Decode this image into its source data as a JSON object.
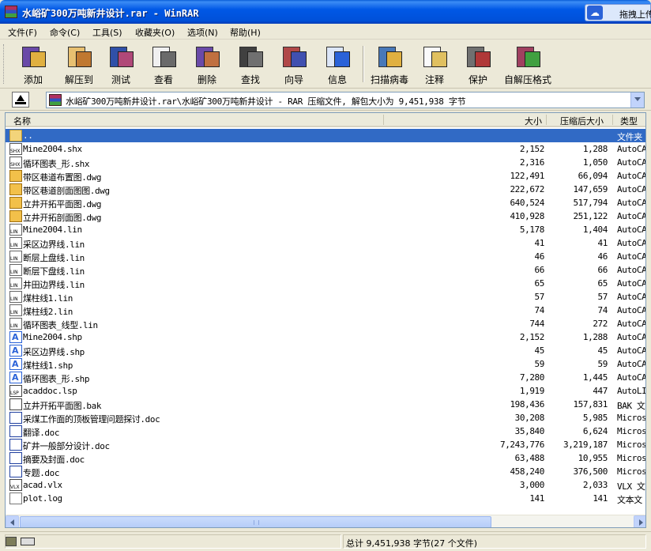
{
  "window": {
    "title": "水峪矿300万吨新井设计.rar - WinRAR",
    "extension_button_label": "拖拽上传"
  },
  "menu": [
    {
      "label": "文件(F)"
    },
    {
      "label": "命令(C)"
    },
    {
      "label": "工具(S)"
    },
    {
      "label": "收藏夹(O)"
    },
    {
      "label": "选项(N)"
    },
    {
      "label": "帮助(H)"
    }
  ],
  "toolbar": [
    {
      "label": "添加",
      "icon": "add-archive-icon",
      "color": "#6a4aa8"
    },
    {
      "label": "解压到",
      "icon": "extract-to-icon",
      "color": "#d8a040"
    },
    {
      "label": "测试",
      "icon": "test-icon",
      "color": "#3050a8"
    },
    {
      "label": "查看",
      "icon": "view-icon",
      "color": "#6a6a6a"
    },
    {
      "label": "删除",
      "icon": "delete-icon",
      "color": "#c07040"
    },
    {
      "label": "查找",
      "icon": "find-icon",
      "color": "#404040"
    },
    {
      "label": "向导",
      "icon": "wizard-icon",
      "color": "#b04848"
    },
    {
      "label": "信息",
      "icon": "info-icon",
      "color": "#2a62d8"
    },
    {
      "label": "扫描病毒",
      "icon": "virus-scan-icon",
      "color": "#4878b8"
    },
    {
      "label": "注释",
      "icon": "comment-icon",
      "color": "#e0c060"
    },
    {
      "label": "保护",
      "icon": "protect-icon",
      "color": "#707070"
    },
    {
      "label": "自解压格式",
      "icon": "sfx-icon",
      "color": "#a04060"
    }
  ],
  "address": {
    "text": "水峪矿300万吨新井设计.rar\\水峪矿300万吨新井设计 - RAR 压缩文件, 解包大小为 9,451,938 字节"
  },
  "columns": {
    "name": "名称",
    "size": "大小",
    "packed": "压缩后大小",
    "type": "类型"
  },
  "files": [
    {
      "name": "..",
      "size": "",
      "packed": "",
      "type": "文件夹",
      "icon": "folder-up-icon",
      "kind": "folder",
      "tag": ""
    },
    {
      "name": "Mine2004.shx",
      "size": "2,152",
      "packed": "1,288",
      "type": "AutoCA",
      "icon": "shx-file-icon",
      "kind": "shx",
      "tag": "SHX"
    },
    {
      "name": "循环图表_形.shx",
      "size": "2,316",
      "packed": "1,050",
      "type": "AutoCA",
      "icon": "shx-file-icon",
      "kind": "shx",
      "tag": "SHX"
    },
    {
      "name": "带区巷道布置图.dwg",
      "size": "122,491",
      "packed": "66,094",
      "type": "AutoCA",
      "icon": "dwg-file-icon",
      "kind": "dwg",
      "tag": ""
    },
    {
      "name": "带区巷道剖面图图.dwg",
      "size": "222,672",
      "packed": "147,659",
      "type": "AutoCA",
      "icon": "dwg-file-icon",
      "kind": "dwg",
      "tag": ""
    },
    {
      "name": "立井开拓平面图.dwg",
      "size": "640,524",
      "packed": "517,794",
      "type": "AutoCA",
      "icon": "dwg-file-icon",
      "kind": "dwg",
      "tag": ""
    },
    {
      "name": "立井开拓剖面图.dwg",
      "size": "410,928",
      "packed": "251,122",
      "type": "AutoCA",
      "icon": "dwg-file-icon",
      "kind": "dwg",
      "tag": ""
    },
    {
      "name": "Mine2004.lin",
      "size": "5,178",
      "packed": "1,404",
      "type": "AutoCA",
      "icon": "lin-file-icon",
      "kind": "lin",
      "tag": "LIN"
    },
    {
      "name": "采区边界线.lin",
      "size": "41",
      "packed": "41",
      "type": "AutoCA",
      "icon": "lin-file-icon",
      "kind": "lin",
      "tag": "LIN"
    },
    {
      "name": "断层上盘线.lin",
      "size": "46",
      "packed": "46",
      "type": "AutoCA",
      "icon": "lin-file-icon",
      "kind": "lin",
      "tag": "LIN"
    },
    {
      "name": "断层下盘线.lin",
      "size": "66",
      "packed": "66",
      "type": "AutoCA",
      "icon": "lin-file-icon",
      "kind": "lin",
      "tag": "LIN"
    },
    {
      "name": "井田边界线.lin",
      "size": "65",
      "packed": "65",
      "type": "AutoCA",
      "icon": "lin-file-icon",
      "kind": "lin",
      "tag": "LIN"
    },
    {
      "name": "煤柱线1.lin",
      "size": "57",
      "packed": "57",
      "type": "AutoCA",
      "icon": "lin-file-icon",
      "kind": "lin",
      "tag": "LIN"
    },
    {
      "name": "煤柱线2.lin",
      "size": "74",
      "packed": "74",
      "type": "AutoCA",
      "icon": "lin-file-icon",
      "kind": "lin",
      "tag": "LIN"
    },
    {
      "name": "循环图表_线型.lin",
      "size": "744",
      "packed": "272",
      "type": "AutoCA",
      "icon": "lin-file-icon",
      "kind": "lin",
      "tag": "LIN"
    },
    {
      "name": "Mine2004.shp",
      "size": "2,152",
      "packed": "1,288",
      "type": "AutoCA",
      "icon": "shp-file-icon",
      "kind": "shp",
      "tag": ""
    },
    {
      "name": "采区边界线.shp",
      "size": "45",
      "packed": "45",
      "type": "AutoCA",
      "icon": "shp-file-icon",
      "kind": "shp",
      "tag": ""
    },
    {
      "name": "煤柱线1.shp",
      "size": "59",
      "packed": "59",
      "type": "AutoCA",
      "icon": "shp-file-icon",
      "kind": "shp",
      "tag": ""
    },
    {
      "name": "循环图表_形.shp",
      "size": "7,280",
      "packed": "1,445",
      "type": "AutoCA",
      "icon": "shp-file-icon",
      "kind": "shp",
      "tag": ""
    },
    {
      "name": "acaddoc.lsp",
      "size": "1,919",
      "packed": "447",
      "type": "AutoLI",
      "icon": "lsp-file-icon",
      "kind": "lsp",
      "tag": "LSP"
    },
    {
      "name": "立井开拓平面图.bak",
      "size": "198,436",
      "packed": "157,831",
      "type": "BAK 文",
      "icon": "bak-file-icon",
      "kind": "bak",
      "tag": ""
    },
    {
      "name": "采煤工作面的顶板管理问题探讨.doc",
      "size": "30,208",
      "packed": "5,985",
      "type": "Micros",
      "icon": "doc-file-icon",
      "kind": "doc",
      "tag": ""
    },
    {
      "name": "翻译.doc",
      "size": "35,840",
      "packed": "6,624",
      "type": "Micros",
      "icon": "doc-file-icon",
      "kind": "doc",
      "tag": ""
    },
    {
      "name": "矿井一般部分设计.doc",
      "size": "7,243,776",
      "packed": "3,219,187",
      "type": "Micros",
      "icon": "doc-file-icon",
      "kind": "doc",
      "tag": ""
    },
    {
      "name": "摘要及封面.doc",
      "size": "63,488",
      "packed": "10,955",
      "type": "Micros",
      "icon": "doc-file-icon",
      "kind": "doc",
      "tag": ""
    },
    {
      "name": "专题.doc",
      "size": "458,240",
      "packed": "376,500",
      "type": "Micros",
      "icon": "doc-file-icon",
      "kind": "doc",
      "tag": ""
    },
    {
      "name": "acad.vlx",
      "size": "3,000",
      "packed": "2,033",
      "type": "VLX 文",
      "icon": "vlx-file-icon",
      "kind": "vlx",
      "tag": "VLX"
    },
    {
      "name": "plot.log",
      "size": "141",
      "packed": "141",
      "type": "文本文",
      "icon": "log-file-icon",
      "kind": "log",
      "tag": ""
    }
  ],
  "status": {
    "left": "",
    "right": "总计 9,451,938 字节(27 个文件)"
  }
}
